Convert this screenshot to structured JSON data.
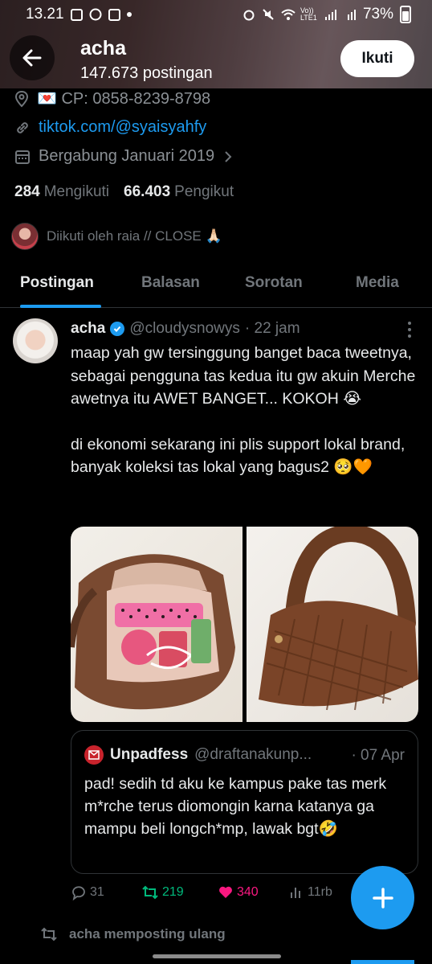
{
  "status_bar": {
    "time": "13.21",
    "carrier": "Vo)) LTE1",
    "battery": "73%"
  },
  "header": {
    "name": "acha",
    "posts_count": "147.673 postingan",
    "follow_label": "Ikuti"
  },
  "profile": {
    "contact": "💌 CP: 0858-8239-8798",
    "link": "tiktok.com/@syaisyahfy",
    "joined": "Bergabung Januari 2019",
    "following_count": "284",
    "following_label": "Mengikuti",
    "followers_count": "66.403",
    "followers_label": "Pengikut",
    "followed_by": "Diikuti oleh raia // CLOSE 🙏🏻"
  },
  "tabs": [
    {
      "label": "Postingan",
      "active": true
    },
    {
      "label": "Balasan",
      "active": false
    },
    {
      "label": "Sorotan",
      "active": false
    },
    {
      "label": "Media",
      "active": false
    }
  ],
  "tweet": {
    "name": "acha",
    "handle": "@cloudysnowys",
    "time": "· 22 jam",
    "text_p1": "maap yah gw tersinggung banget baca tweetnya, sebagai pengguna tas kedua itu gw akuin Merche awetnya itu AWET BANGET... KOKOH 😭",
    "text_p2": "di ekonomi sekarang ini plis support lokal brand, banyak koleksi tas lokal yang bagus2 🥺🧡",
    "quote": {
      "name": "Unpadfess",
      "handle": "@draftanakunp...",
      "time": "· 07 Apr",
      "text": "pad! sedih td aku ke kampus pake tas merk m*rche terus diomongin karna katanya ga mampu beli longch*mp, lawak bgt🤣"
    },
    "stats": {
      "replies": "31",
      "retweets": "219",
      "likes": "340",
      "views": "11rb"
    }
  },
  "repost_label": "acha memposting ulang",
  "colors": {
    "accent": "#1d9bf0",
    "retweet": "#00ba7c",
    "like": "#f91880",
    "muted": "#71767b"
  }
}
